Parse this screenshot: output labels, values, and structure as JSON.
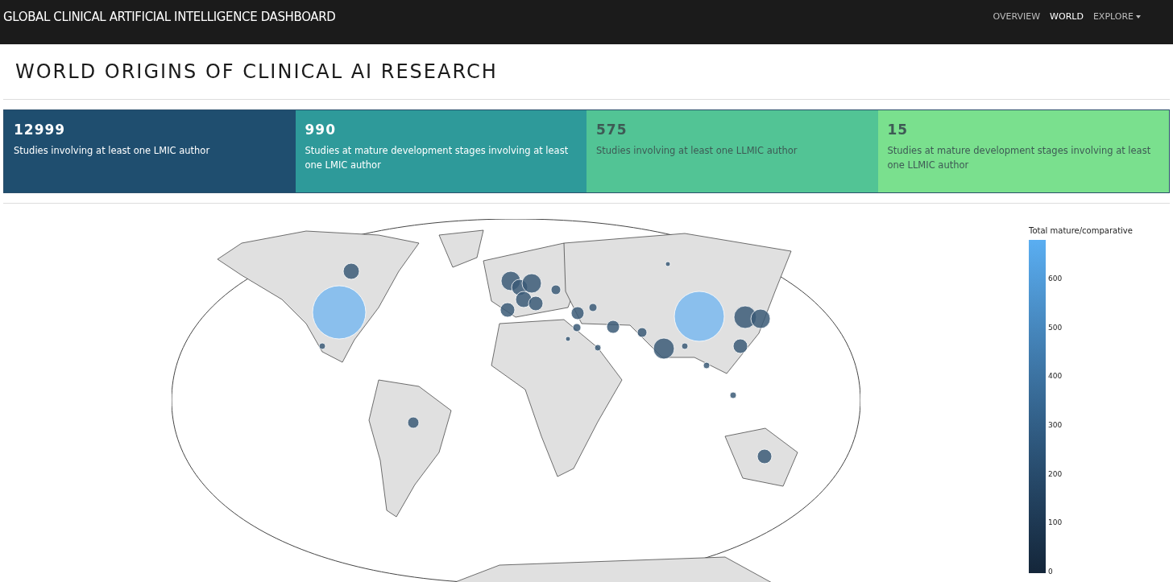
{
  "navbar": {
    "brand": "GLOBAL CLINICAL ARTIFICIAL INTELLIGENCE DASHBOARD",
    "items": [
      {
        "label": "OVERVIEW",
        "selected": false,
        "kind": "link"
      },
      {
        "label": "WORLD",
        "selected": true,
        "kind": "link"
      },
      {
        "label": "EXPLORE",
        "selected": false,
        "kind": "dropdown"
      }
    ]
  },
  "page_title": "WORLD ORIGINS OF CLINICAL AI RESEARCH",
  "stats": [
    {
      "value": "12999",
      "label": "Studies involving at least one LMIC author",
      "color": "#1f4e6f"
    },
    {
      "value": "990",
      "label": "Studies at mature development stages involving at least one LMIC author",
      "color": "#2e9a9a"
    },
    {
      "value": "575",
      "label": "Studies involving at least one LLMIC author",
      "color": "#52c495"
    },
    {
      "value": "15",
      "label": "Studies at mature development stages involving at least one LLMIC author",
      "color": "#7ae08e"
    }
  ],
  "map": {
    "colorbar": {
      "title": "Total mature/comparative",
      "ticks": [
        "600",
        "500",
        "400",
        "300",
        "200",
        "100",
        "0"
      ]
    }
  }
}
